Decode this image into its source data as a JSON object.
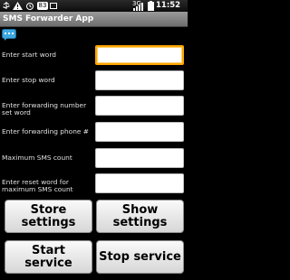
{
  "status_bar": {
    "notification_count": "83",
    "network_type": "3G",
    "time": "11:52 PM",
    "icons": [
      "usb-icon",
      "warning-icon",
      "alarm-icon",
      "notification-icon",
      "signal-icon",
      "battery-icon"
    ]
  },
  "title_bar": {
    "title": "SMS Forwarder App"
  },
  "form": {
    "fields": [
      {
        "label": "Enter start word",
        "value": ""
      },
      {
        "label": "Enter stop word",
        "value": ""
      },
      {
        "label": "Enter forwarding number set word",
        "value": ""
      },
      {
        "label": "Enter forwarding phone #",
        "value": ""
      },
      {
        "label": "Maximum SMS count",
        "value": ""
      },
      {
        "label": "Enter reset word for maximum SMS count",
        "value": ""
      }
    ]
  },
  "buttons": {
    "store_settings": "Store settings",
    "show_settings": "Show settings",
    "start_service": "Start service",
    "stop_service": "Stop service"
  },
  "colors": {
    "focus": "#ffa500",
    "title_bar": "#8a8a8a",
    "background": "#000000"
  }
}
